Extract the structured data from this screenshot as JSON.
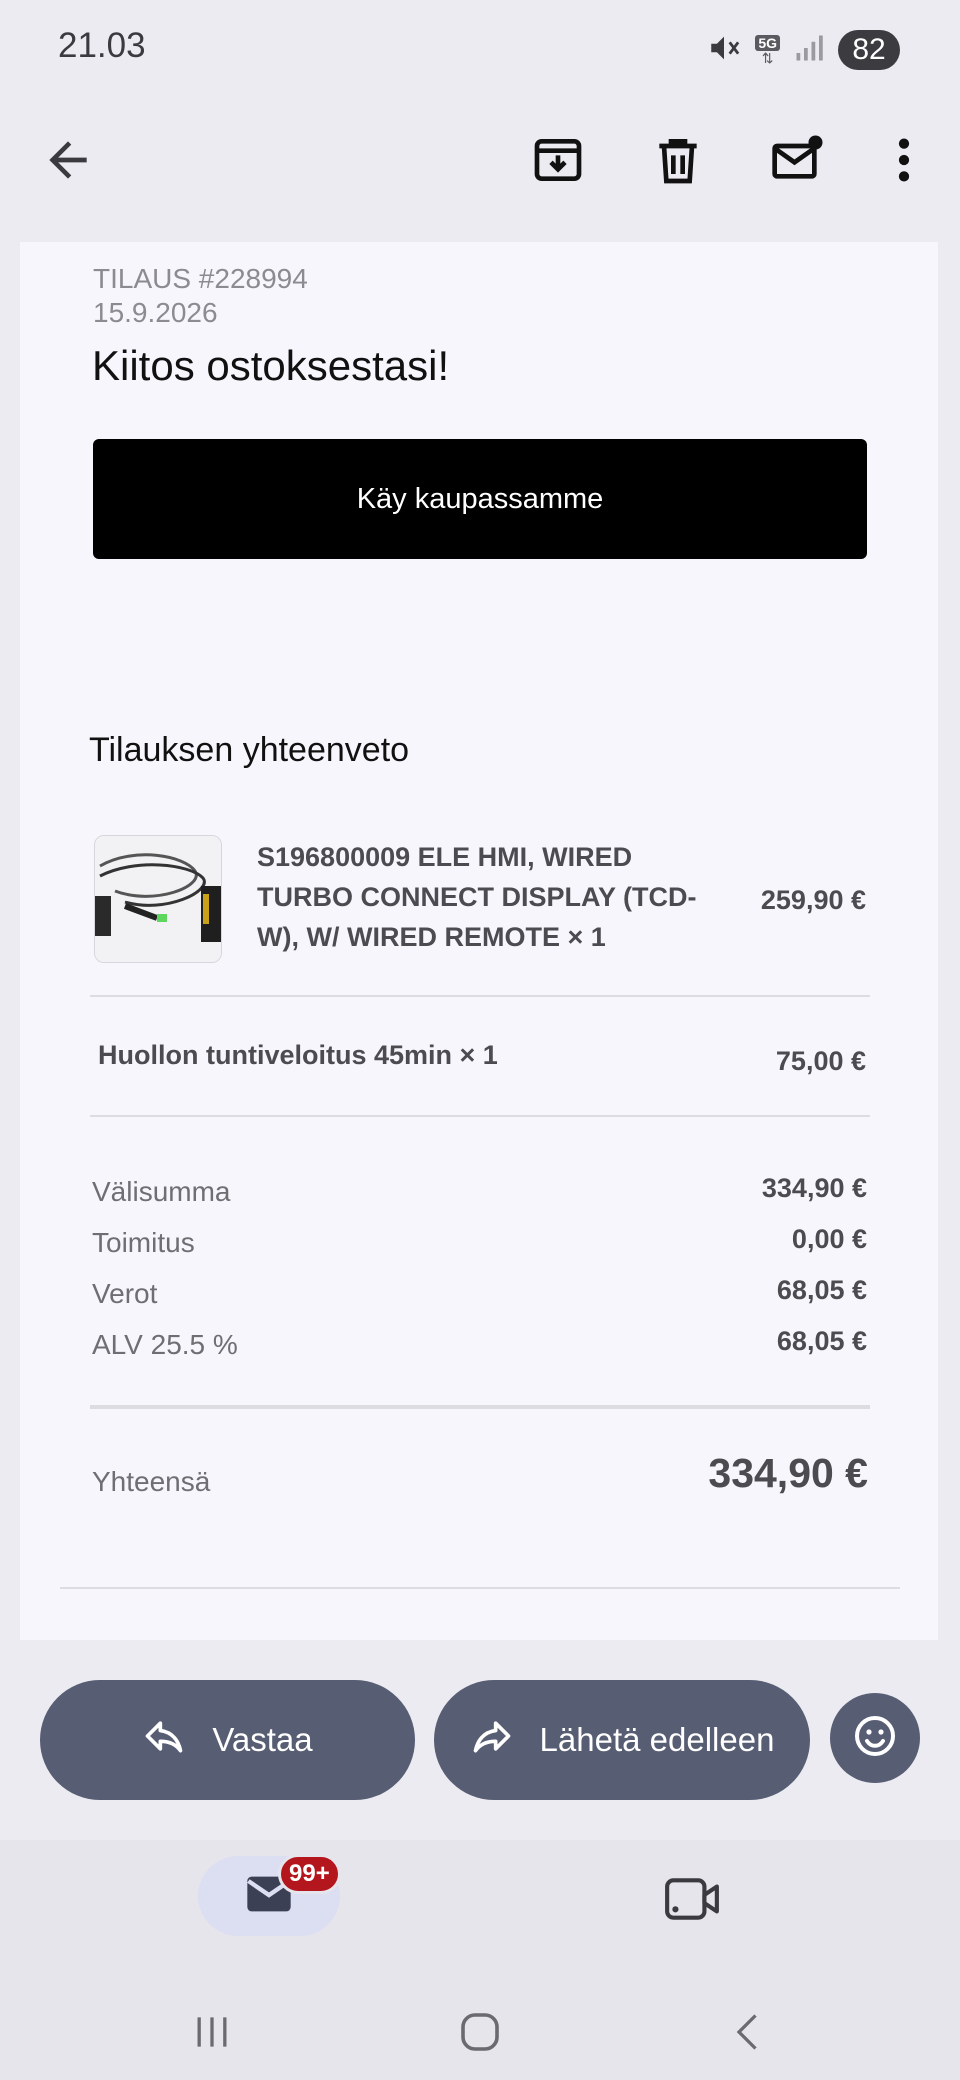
{
  "status_bar": {
    "time": "21.03",
    "network_label": "5G",
    "battery_level": "82"
  },
  "email": {
    "order_number": "TILAUS #228994",
    "order_date": "15.9.2026",
    "heading": "Kiitos ostoksestasi!",
    "shop_button_label": "Käy kaupassamme",
    "summary_heading": "Tilauksen yhteenveto",
    "line_items": [
      {
        "name": "S196800009 ELE HMI, WIRED TURBO CONNECT DISPLAY (TCD-W), W/ WIRED REMOTE × 1",
        "price": "259,90 €"
      },
      {
        "name": "Huollon tuntiveloitus 45min × 1",
        "price": "75,00 €"
      }
    ],
    "totals": [
      {
        "label": "Välisumma",
        "value": "334,90 €"
      },
      {
        "label": "Toimitus",
        "value": "0,00 €"
      },
      {
        "label": "Verot",
        "value": "68,05 €"
      },
      {
        "label": "ALV 25.5 %",
        "value": "68,05 €"
      }
    ],
    "grand_total": {
      "label": "Yhteensä",
      "value": "334,90 €"
    }
  },
  "actions": {
    "reply_label": "Vastaa",
    "forward_label": "Lähetä edelleen"
  },
  "bottom_nav": {
    "unread_badge": "99+"
  },
  "icons": {
    "back": "arrow-left-icon",
    "archive": "archive-icon",
    "delete": "trash-icon",
    "mark_unread": "mail-unread-icon",
    "more": "more-vert-icon",
    "reply": "reply-icon",
    "forward": "forward-icon",
    "emoji": "emoji-icon",
    "mail": "mail-icon",
    "meet": "video-icon"
  },
  "colors": {
    "action_pill": "#575d73",
    "badge": "#b3161c",
    "shop_button": "#000000"
  }
}
